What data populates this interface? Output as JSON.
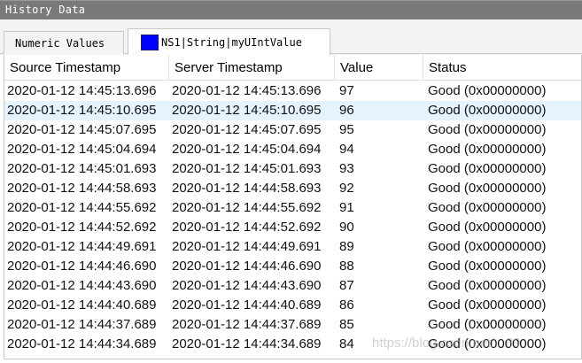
{
  "window": {
    "title": "History Data"
  },
  "tabs": [
    {
      "label": "Numeric Values",
      "active": false
    },
    {
      "label": "NS1|String|myUIntValue",
      "active": true,
      "swatch_color": "#0000ff"
    }
  ],
  "table": {
    "columns": [
      "Source Timestamp",
      "Server Timestamp",
      "Value",
      "Status"
    ],
    "selected_row": 1,
    "rows": [
      [
        "2020-01-12 14:45:13.696",
        "2020-01-12 14:45:13.696",
        "97",
        "Good (0x00000000)"
      ],
      [
        "2020-01-12 14:45:10.695",
        "2020-01-12 14:45:10.695",
        "96",
        "Good (0x00000000)"
      ],
      [
        "2020-01-12 14:45:07.695",
        "2020-01-12 14:45:07.695",
        "95",
        "Good (0x00000000)"
      ],
      [
        "2020-01-12 14:45:04.694",
        "2020-01-12 14:45:04.694",
        "94",
        "Good (0x00000000)"
      ],
      [
        "2020-01-12 14:45:01.693",
        "2020-01-12 14:45:01.693",
        "93",
        "Good (0x00000000)"
      ],
      [
        "2020-01-12 14:44:58.693",
        "2020-01-12 14:44:58.693",
        "92",
        "Good (0x00000000)"
      ],
      [
        "2020-01-12 14:44:55.692",
        "2020-01-12 14:44:55.692",
        "91",
        "Good (0x00000000)"
      ],
      [
        "2020-01-12 14:44:52.692",
        "2020-01-12 14:44:52.692",
        "90",
        "Good (0x00000000)"
      ],
      [
        "2020-01-12 14:44:49.691",
        "2020-01-12 14:44:49.691",
        "89",
        "Good (0x00000000)"
      ],
      [
        "2020-01-12 14:44:46.690",
        "2020-01-12 14:44:46.690",
        "88",
        "Good (0x00000000)"
      ],
      [
        "2020-01-12 14:44:43.690",
        "2020-01-12 14:44:43.690",
        "87",
        "Good (0x00000000)"
      ],
      [
        "2020-01-12 14:44:40.689",
        "2020-01-12 14:44:40.689",
        "86",
        "Good (0x00000000)"
      ],
      [
        "2020-01-12 14:44:37.689",
        "2020-01-12 14:44:37.689",
        "85",
        "Good (0x00000000)"
      ],
      [
        "2020-01-12 14:44:34.689",
        "2020-01-12 14:44:34.689",
        "84",
        "Good (0x00000000)"
      ]
    ]
  },
  "watermark": "https://blog.csdn.net/...89"
}
